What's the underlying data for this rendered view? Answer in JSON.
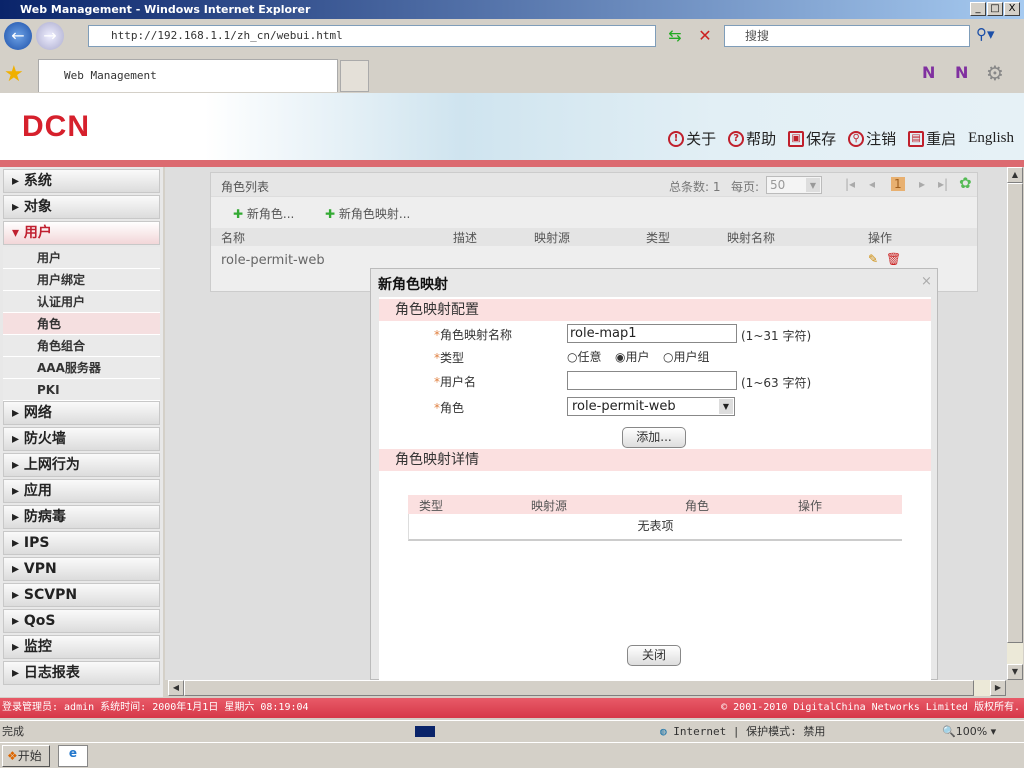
{
  "window": {
    "title": "Web Management - Windows Internet Explorer",
    "min": "_",
    "max": "□",
    "close": "X"
  },
  "browser": {
    "url": "http://192.168.1.1/zh_cn/webui.html",
    "search_placeholder": "搜搜",
    "tab_title": "Web Management"
  },
  "header": {
    "logo": "DCN",
    "links": [
      {
        "icon": "!",
        "label": "关于"
      },
      {
        "icon": "?",
        "label": "帮助"
      },
      {
        "icon": "▣",
        "label": "保存"
      },
      {
        "icon": "⚲",
        "label": "注销"
      },
      {
        "icon": "▤",
        "label": "重启"
      }
    ],
    "english": "English"
  },
  "sidebar": {
    "groups_top": [
      "系统",
      "对象"
    ],
    "open_group": "用户",
    "subs": [
      "用户",
      "用户绑定",
      "认证用户",
      "角色",
      "角色组合",
      "AAA服务器",
      "PKI"
    ],
    "groups_bottom": [
      "网络",
      "防火墙",
      "上网行为",
      "应用",
      "防病毒",
      "IPS",
      "VPN",
      "SCVPN",
      "QoS",
      "监控",
      "日志报表"
    ]
  },
  "panel": {
    "title": "角色列表",
    "total_label": "总条数: 1",
    "per_page_label": "每页:",
    "per_page": "50",
    "page": "1",
    "new_role": "新角色...",
    "new_mapping": "新角色映射...",
    "columns": [
      "名称",
      "描述",
      "映射源",
      "类型",
      "映射名称",
      "操作"
    ],
    "rows": [
      {
        "name": "role-permit-web"
      }
    ]
  },
  "dialog": {
    "title": "新角色映射",
    "config_section": "角色映射配置",
    "fields": {
      "name_label": "角色映射名称",
      "name_value": "role-map1",
      "name_hint": "(1~31 字符)",
      "type_label": "类型",
      "type_options": [
        "任意",
        "用户",
        "用户组"
      ],
      "type_selected": "用户",
      "user_label": "用户名",
      "user_value": "",
      "user_hint": "(1~63 字符)",
      "role_label": "角色",
      "role_value": "role-permit-web"
    },
    "add_button": "添加...",
    "detail_section": "角色映射详情",
    "detail_columns": [
      "类型",
      "映射源",
      "角色",
      "操作"
    ],
    "empty": "无表项",
    "close_button": "关闭"
  },
  "footer": {
    "left": "登录管理员: admin 系统时间: 2000年1月1日 星期六 08:19:04",
    "right": "© 2001-2010 DigitalChina Networks Limited 版权所有."
  },
  "status": {
    "text": "完成",
    "zone": "Internet | 保护模式: 禁用",
    "zoom": "100%"
  },
  "taskbar": {
    "start": "开始"
  }
}
